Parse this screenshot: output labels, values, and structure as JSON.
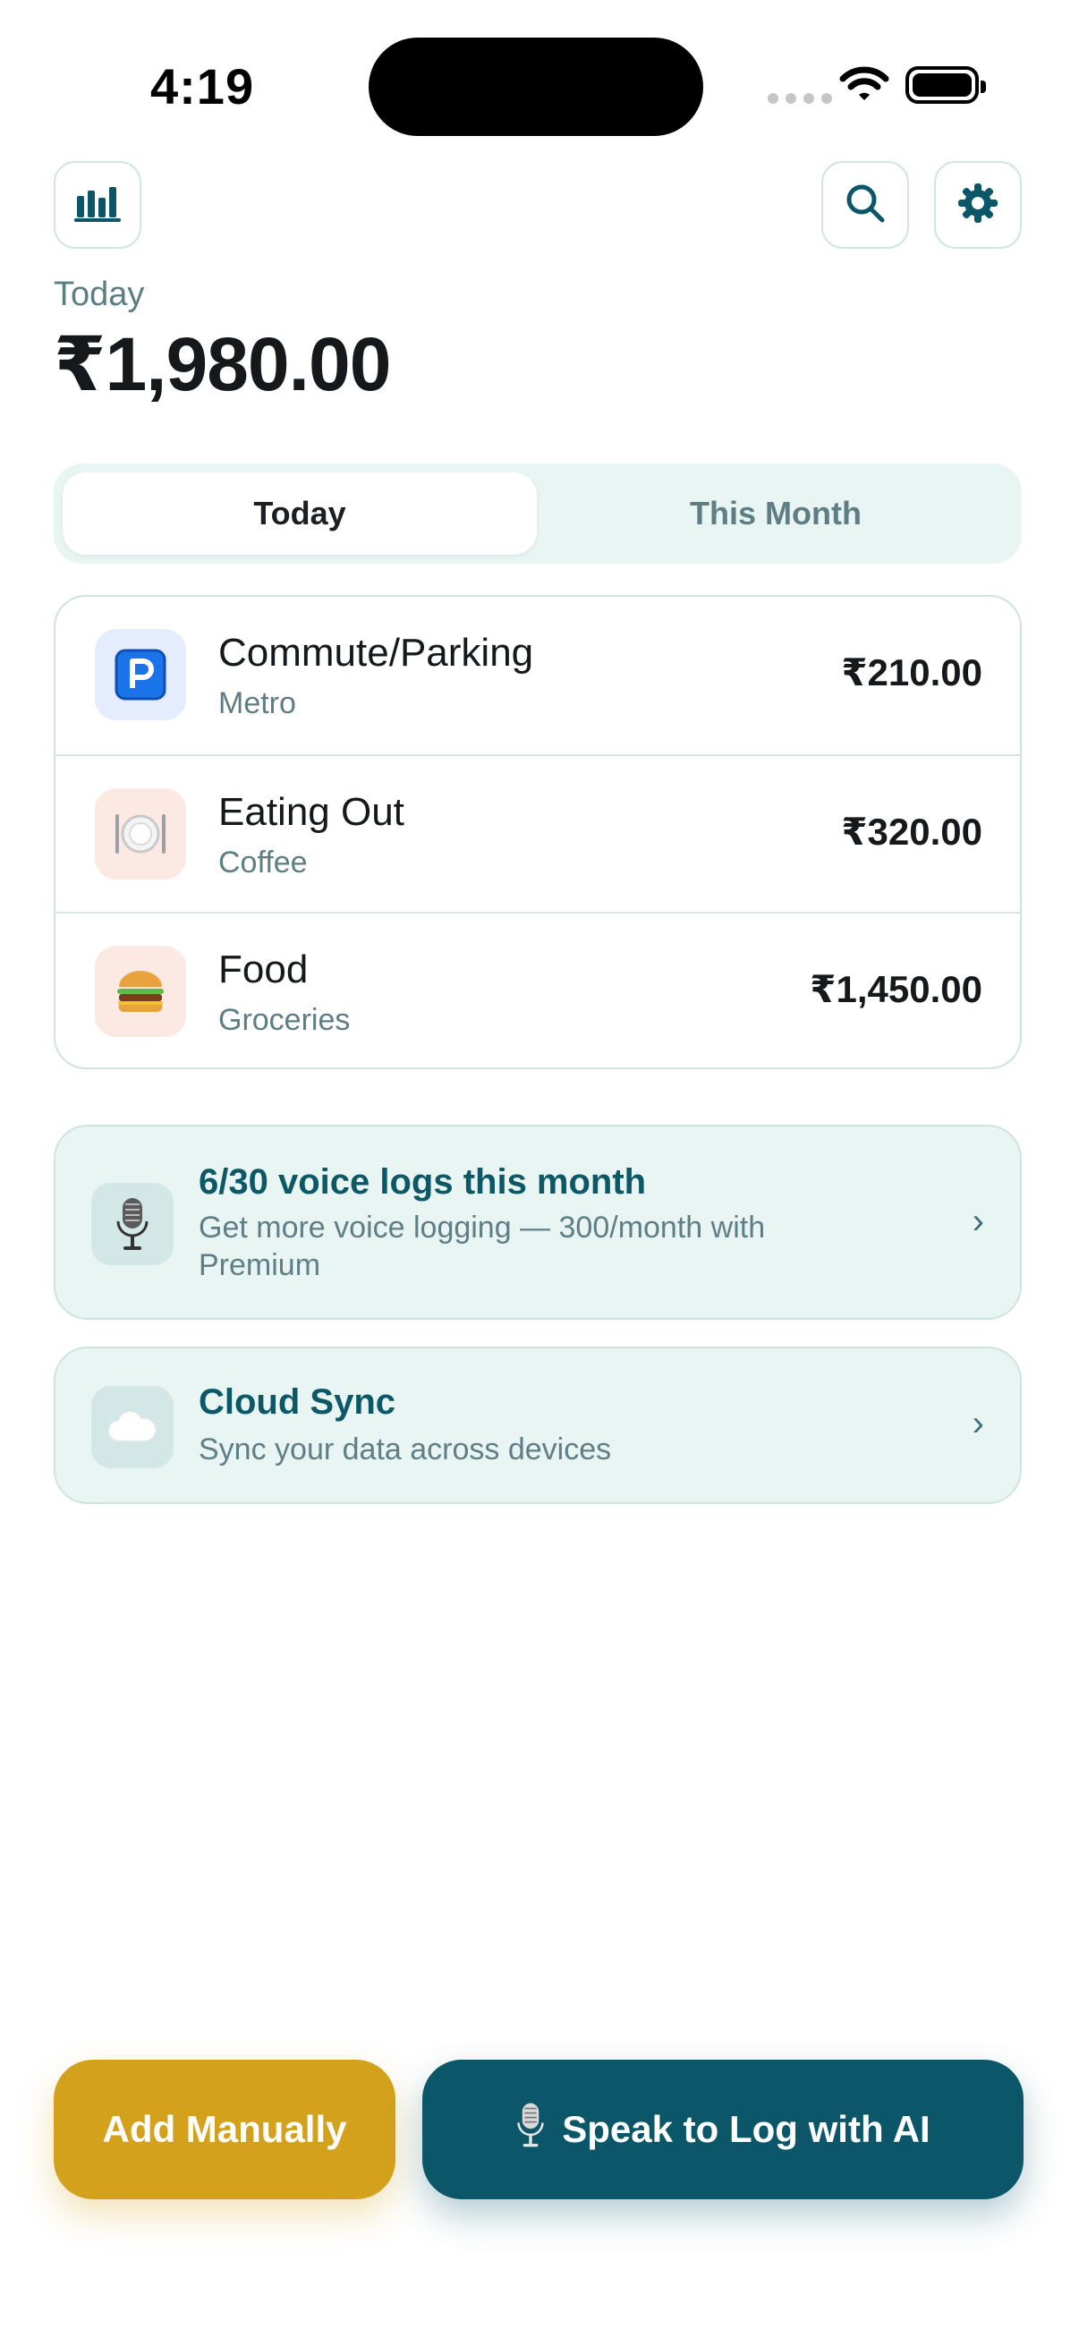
{
  "status_bar": {
    "time": "4:19"
  },
  "header": {
    "period_label": "Today",
    "total_amount": "₹1,980.00"
  },
  "tabs": [
    {
      "label": "Today",
      "selected": true
    },
    {
      "label": "This Month",
      "selected": false
    }
  ],
  "expenses": [
    {
      "title": "Commute/Parking",
      "subtitle": "Metro",
      "amount": "₹210.00",
      "icon": "parking-icon",
      "icon_bg": "#e4ecfd"
    },
    {
      "title": "Eating Out",
      "subtitle": "Coffee",
      "amount": "₹320.00",
      "icon": "plate-cutlery-icon",
      "icon_bg": "#fde9e3"
    },
    {
      "title": "Food",
      "subtitle": "Groceries",
      "amount": "₹1,450.00",
      "icon": "burger-icon",
      "icon_bg": "#fde9e3"
    }
  ],
  "voice_promo": {
    "title": "6/30 voice logs this month",
    "subtitle": "Get more voice logging — 300/month with Premium",
    "icon": "microphone-icon"
  },
  "cloud_promo": {
    "title": "Cloud Sync",
    "subtitle": "Sync your data across devices",
    "icon": "cloud-icon"
  },
  "actions": {
    "manual_label": "Add Manually",
    "ai_label": "Speak to Log with AI"
  },
  "colors": {
    "primary": "#0b5669",
    "accent": "#d4a11c",
    "tint_bg": "#e8f5f2"
  }
}
